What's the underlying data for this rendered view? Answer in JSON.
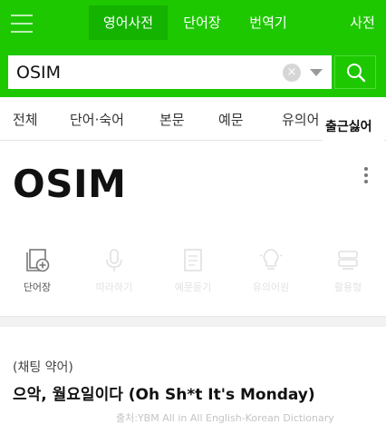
{
  "header": {
    "tabs": [
      {
        "label": "영어사전",
        "active": true
      },
      {
        "label": "단어장",
        "active": false
      },
      {
        "label": "번역기",
        "active": false
      },
      {
        "label": "사전",
        "active": false
      }
    ]
  },
  "search": {
    "value": "OSIM",
    "clear_glyph": "×"
  },
  "categories": [
    {
      "label": "전체"
    },
    {
      "label": "단어·숙어"
    },
    {
      "label": "본문"
    },
    {
      "label": "예문"
    },
    {
      "label": "유의어"
    }
  ],
  "overlay_text": "출근싫어",
  "entry": {
    "word": "OSIM",
    "actions": [
      {
        "label": "단어장",
        "icon": "add-to-wordbook-icon"
      },
      {
        "label": "따라하기",
        "icon": "microphone-icon"
      },
      {
        "label": "예문듣기",
        "icon": "document-icon"
      },
      {
        "label": "유의어원",
        "icon": "lightbulb-icon"
      },
      {
        "label": "활용형",
        "icon": "stack-icon"
      }
    ],
    "part_of_speech": "(채팅 약어)",
    "meaning": "으악, 월요일이다 (Oh Sh*t It's Monday)",
    "source": "출처:YBM All in All English-Korean Dictionary"
  },
  "colors": {
    "brand_green": "#1ec800",
    "active_tab": "#14b300"
  }
}
